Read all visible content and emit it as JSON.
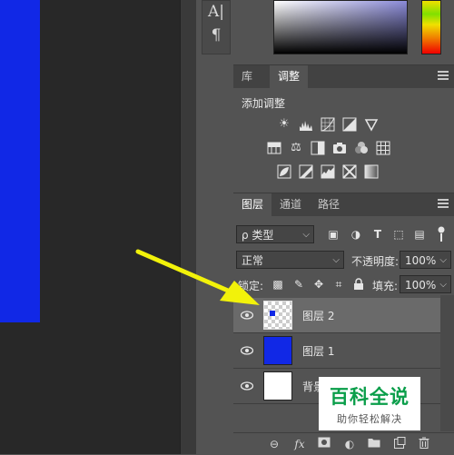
{
  "tools": {
    "char_tool": "A|",
    "para_tool": "¶"
  },
  "adjust_panel": {
    "tabs": [
      {
        "label": "库"
      },
      {
        "label": "调整"
      }
    ],
    "title": "添加调整",
    "rows": [
      [
        "brightness-contrast-icon",
        "levels-icon",
        "curves-icon",
        "exposure-icon",
        "vibrance-icon"
      ],
      [
        "hue-saturation-icon",
        "color-balance-icon",
        "black-white-icon",
        "photo-filter-icon",
        "channel-mixer-icon",
        "color-lookup-icon"
      ],
      [
        "invert-icon",
        "posterize-icon",
        "threshold-icon",
        "selective-color-icon",
        "gradient-map-icon"
      ]
    ]
  },
  "layers_panel": {
    "tabs": [
      {
        "label": "图层"
      },
      {
        "label": "通道"
      },
      {
        "label": "路径"
      }
    ],
    "filter_label": "ρ 类型",
    "blend_mode": "正常",
    "opacity_label": "不透明度:",
    "opacity_value": "100%",
    "lock_label": "锁定:",
    "fill_label": "填充:",
    "fill_value": "100%",
    "layers": [
      {
        "name": "图层 2",
        "thumb": "transparent",
        "selected": true
      },
      {
        "name": "图层 1",
        "thumb": "#1128e6",
        "selected": false
      },
      {
        "name": "背景",
        "thumb": "#ffffff",
        "selected": false
      }
    ],
    "footer_icons": [
      "link-icon",
      "fx-icon",
      "mask-icon",
      "adjustment-layer-icon",
      "group-folder-icon",
      "new-layer-icon",
      "trash-icon"
    ]
  },
  "watermark": {
    "title": "百科全说",
    "subtitle": "助你轻松解决"
  },
  "colors": {
    "canvas_bg": "#282828",
    "layer_blue": "#1128e6",
    "panel_bg": "#535353",
    "arrow": "#f2f20a",
    "watermark_green": "#0a9e4a"
  }
}
